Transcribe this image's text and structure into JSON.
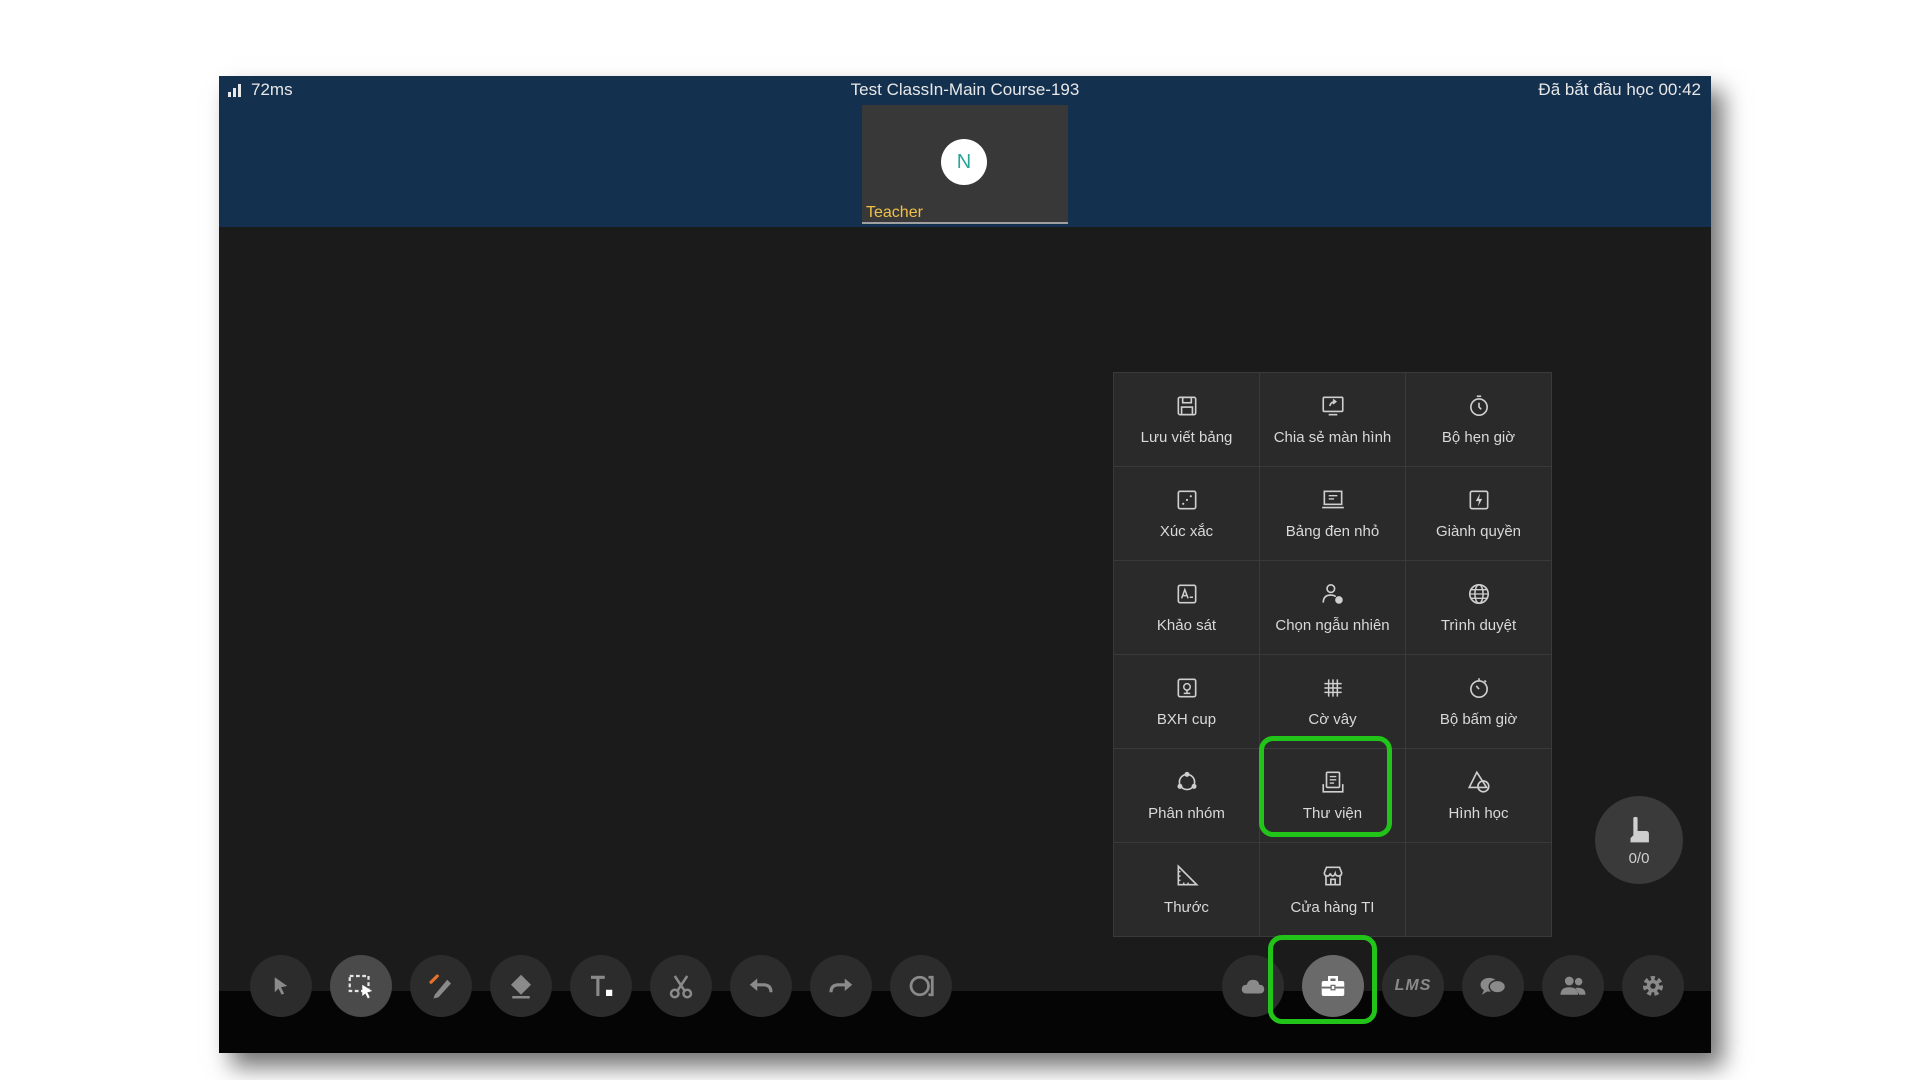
{
  "header": {
    "latency": "72ms",
    "course_title": "Test ClassIn-Main Course-193",
    "class_status": "Đã bắt đầu học 00:42"
  },
  "teacher": {
    "avatar_initial": "N",
    "role_label": "Teacher"
  },
  "toolbox": {
    "items": [
      {
        "label": "Lưu viết bảng",
        "icon": "save-icon"
      },
      {
        "label": "Chia sẻ màn hình",
        "icon": "screen-share-icon"
      },
      {
        "label": "Bộ hẹn giờ",
        "icon": "timer-icon"
      },
      {
        "label": "Xúc xắc",
        "icon": "dice-icon"
      },
      {
        "label": "Bảng đen nhỏ",
        "icon": "small-blackboard-icon"
      },
      {
        "label": "Giành quyền",
        "icon": "responder-icon"
      },
      {
        "label": "Khảo sát",
        "icon": "survey-icon"
      },
      {
        "label": "Chọn ngẫu nhiên",
        "icon": "random-select-icon"
      },
      {
        "label": "Trình duyệt",
        "icon": "browser-globe-icon"
      },
      {
        "label": "BXH cup",
        "icon": "trophy-ranking-icon"
      },
      {
        "label": "Cờ vây",
        "icon": "go-board-icon"
      },
      {
        "label": "Bộ bấm giờ",
        "icon": "stopwatch-icon"
      },
      {
        "label": "Phân nhóm",
        "icon": "grouping-icon"
      },
      {
        "label": "Thư viện",
        "icon": "library-icon"
      },
      {
        "label": "Hình học",
        "icon": "geometry-icon"
      },
      {
        "label": "Thước",
        "icon": "ruler-icon"
      },
      {
        "label": "Cửa hàng TI",
        "icon": "store-icon"
      }
    ]
  },
  "hand_raise": {
    "count": "0/0"
  },
  "toolbar": {
    "lms_label": "LMS"
  },
  "colors": {
    "header": "#14304f",
    "highlight": "#22c41a",
    "teacher_label": "#f0c04a",
    "avatar_text": "#2aa59a"
  }
}
